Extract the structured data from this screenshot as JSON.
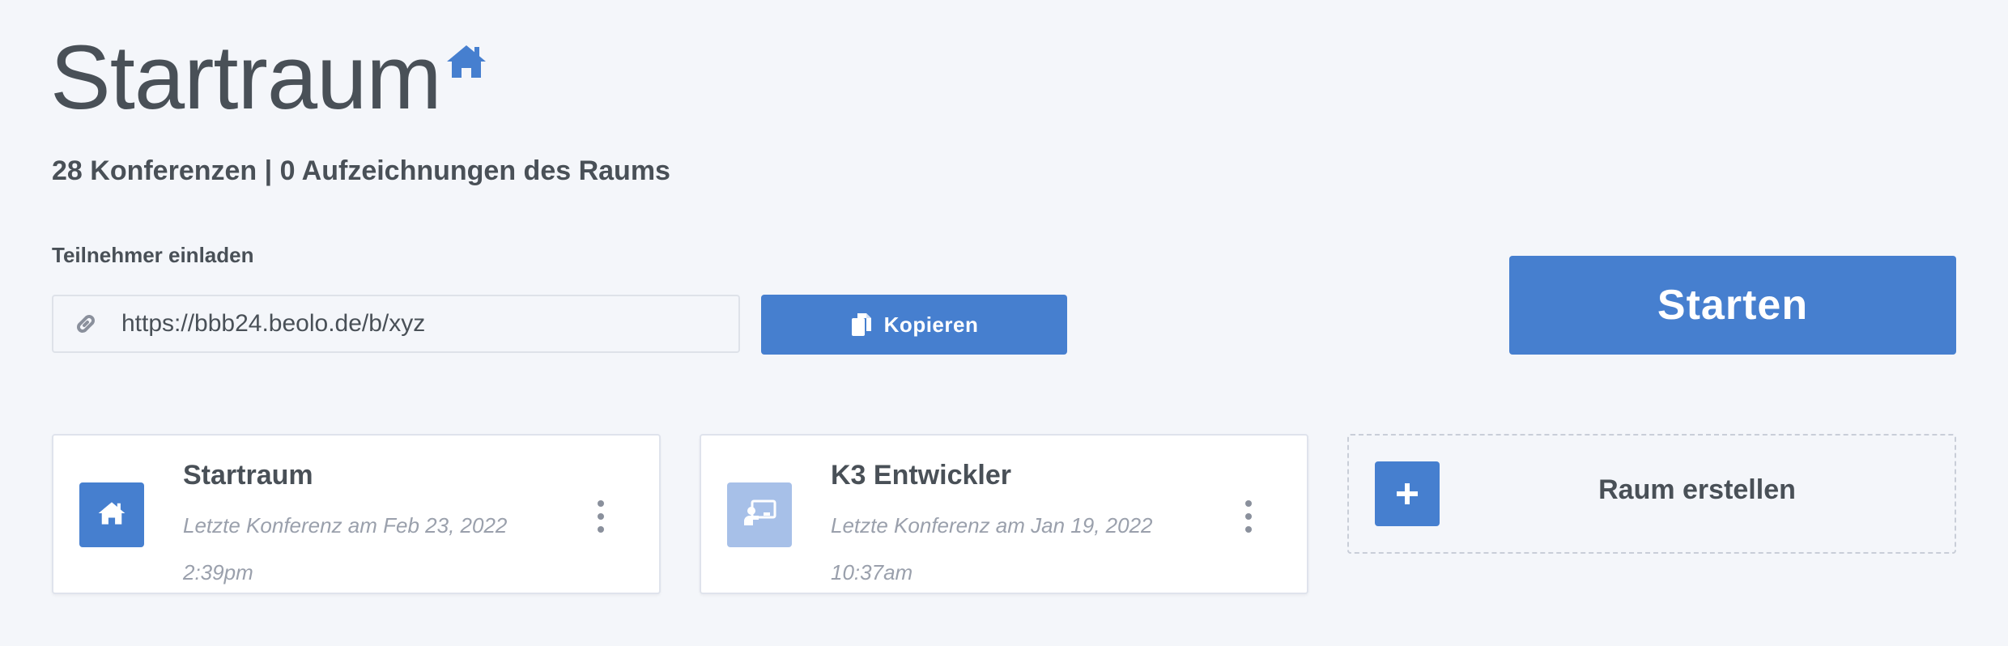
{
  "header": {
    "room_title": "Startraum",
    "title_icon": "home-icon",
    "stats": "28 Konferenzen | 0 Aufzeichnungen des Raums"
  },
  "invite": {
    "label": "Teilnehmer einladen",
    "link_icon": "link-icon",
    "url": "https://bbb24.beolo.de/b/xyz",
    "copy_label": "Kopieren",
    "copy_icon": "copy-icon"
  },
  "start_button": {
    "label": "Starten"
  },
  "rooms": [
    {
      "name": "Startraum",
      "icon": "home-icon",
      "last_conference_date": "Letzte Konferenz am Feb 23, 2022",
      "last_conference_time": "2:39pm"
    },
    {
      "name": "K3 Entwickler",
      "icon": "presentation-icon",
      "last_conference_date": "Letzte Konferenz am Jan 19, 2022",
      "last_conference_time": "10:37am"
    }
  ],
  "create_room": {
    "label": "Raum erstellen",
    "icon": "plus-icon"
  },
  "colors": {
    "primary": "#467fcf",
    "primary_light": "#a7c0e8",
    "background": "#f4f6fa",
    "text": "#495057",
    "muted_text": "#9aa0ac"
  }
}
